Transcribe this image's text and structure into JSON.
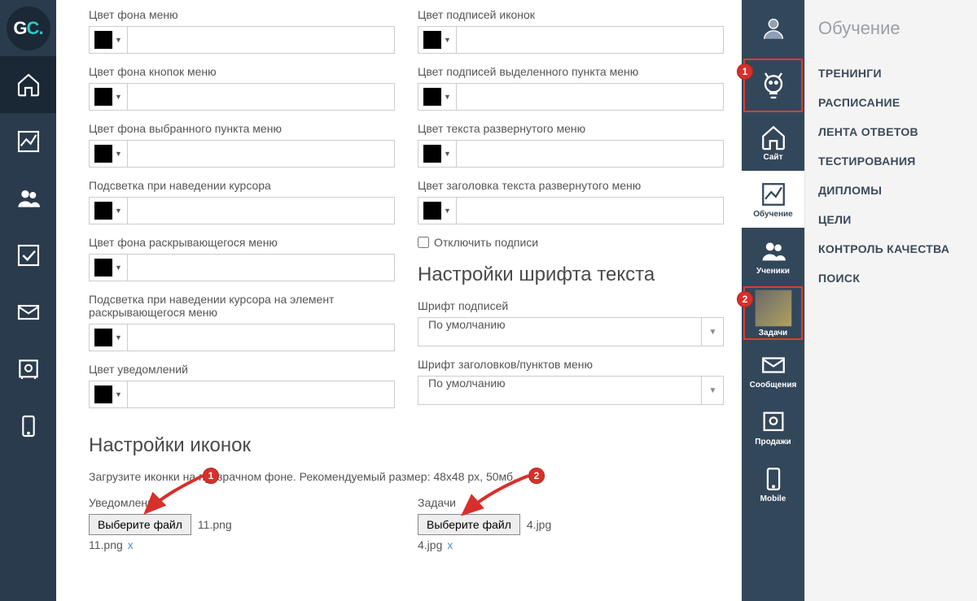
{
  "logo": {
    "g": "G",
    "c": "C",
    "dot": "."
  },
  "left_rail": [
    {
      "name": "home-icon",
      "selected": true
    },
    {
      "name": "chart-icon",
      "selected": false
    },
    {
      "name": "users-icon",
      "selected": false
    },
    {
      "name": "check-icon",
      "selected": false
    },
    {
      "name": "mail-icon",
      "selected": false
    },
    {
      "name": "safe-icon",
      "selected": false
    },
    {
      "name": "mobile-icon",
      "selected": false
    }
  ],
  "left_col": [
    {
      "label": "Цвет фона меню"
    },
    {
      "label": "Цвет фона кнопок меню"
    },
    {
      "label": "Цвет фона выбранного пункта меню"
    },
    {
      "label": "Подсветка при наведении курсора"
    },
    {
      "label": "Цвет фона раскрывающегося меню"
    },
    {
      "label": "Подсветка при наведении курсора на элемент раскрывающегося меню"
    },
    {
      "label": "Цвет уведомлений"
    }
  ],
  "right_col": [
    {
      "label": "Цвет подписей иконок"
    },
    {
      "label": "Цвет подписей выделенного пункта меню"
    },
    {
      "label": "Цвет текста развернутого меню"
    },
    {
      "label": "Цвет заголовка текста развернутого меню"
    }
  ],
  "disable_captions_label": "Отключить подписи",
  "fonts_section_title": "Настройки шрифта текста",
  "font_labels_label": "Шрифт подписей",
  "font_headers_label": "Шрифт заголовков/пунктов меню",
  "font_default": "По умолчанию",
  "icons_section_title": "Настройки иконок",
  "icons_hint": "Загрузите иконки на прозрачном фоне. Рекомендуемый размер: 48х48 px, 50мб.",
  "uploads": [
    {
      "title": "Уведомления",
      "button": "Выберите файл",
      "file": "11.png",
      "link": "11.png",
      "x": "x"
    },
    {
      "title": "Задачи",
      "button": "Выберите файл",
      "file": "4.jpg",
      "link": "4.jpg",
      "x": "x"
    }
  ],
  "side2": [
    {
      "label": "",
      "name": "profile",
      "active": false,
      "highlight": false
    },
    {
      "label": "",
      "name": "idea",
      "active": false,
      "highlight": true
    },
    {
      "label": "Сайт",
      "name": "site",
      "active": false,
      "highlight": false
    },
    {
      "label": "Обучение",
      "name": "learning",
      "active": true,
      "highlight": false
    },
    {
      "label": "Ученики",
      "name": "students",
      "active": false,
      "highlight": false
    },
    {
      "label": "Задачи",
      "name": "tasks",
      "active": false,
      "highlight": true
    },
    {
      "label": "Сообщения",
      "name": "messages",
      "active": false,
      "highlight": false
    },
    {
      "label": "Продажи",
      "name": "sales",
      "active": false,
      "highlight": false
    },
    {
      "label": "Mobile",
      "name": "mobile",
      "active": false,
      "highlight": false
    }
  ],
  "menu": {
    "title": "Обучение",
    "items": [
      "ТРЕНИНГИ",
      "РАСПИСАНИЕ",
      "ЛЕНТА ОТВЕТОВ",
      "ТЕСТИРОВАНИЯ",
      "ДИПЛОМЫ",
      "ЦЕЛИ",
      "КОНТРОЛЬ КАЧЕСТВА",
      "ПОИСК"
    ]
  },
  "annotations": {
    "1": "1",
    "2": "2"
  }
}
